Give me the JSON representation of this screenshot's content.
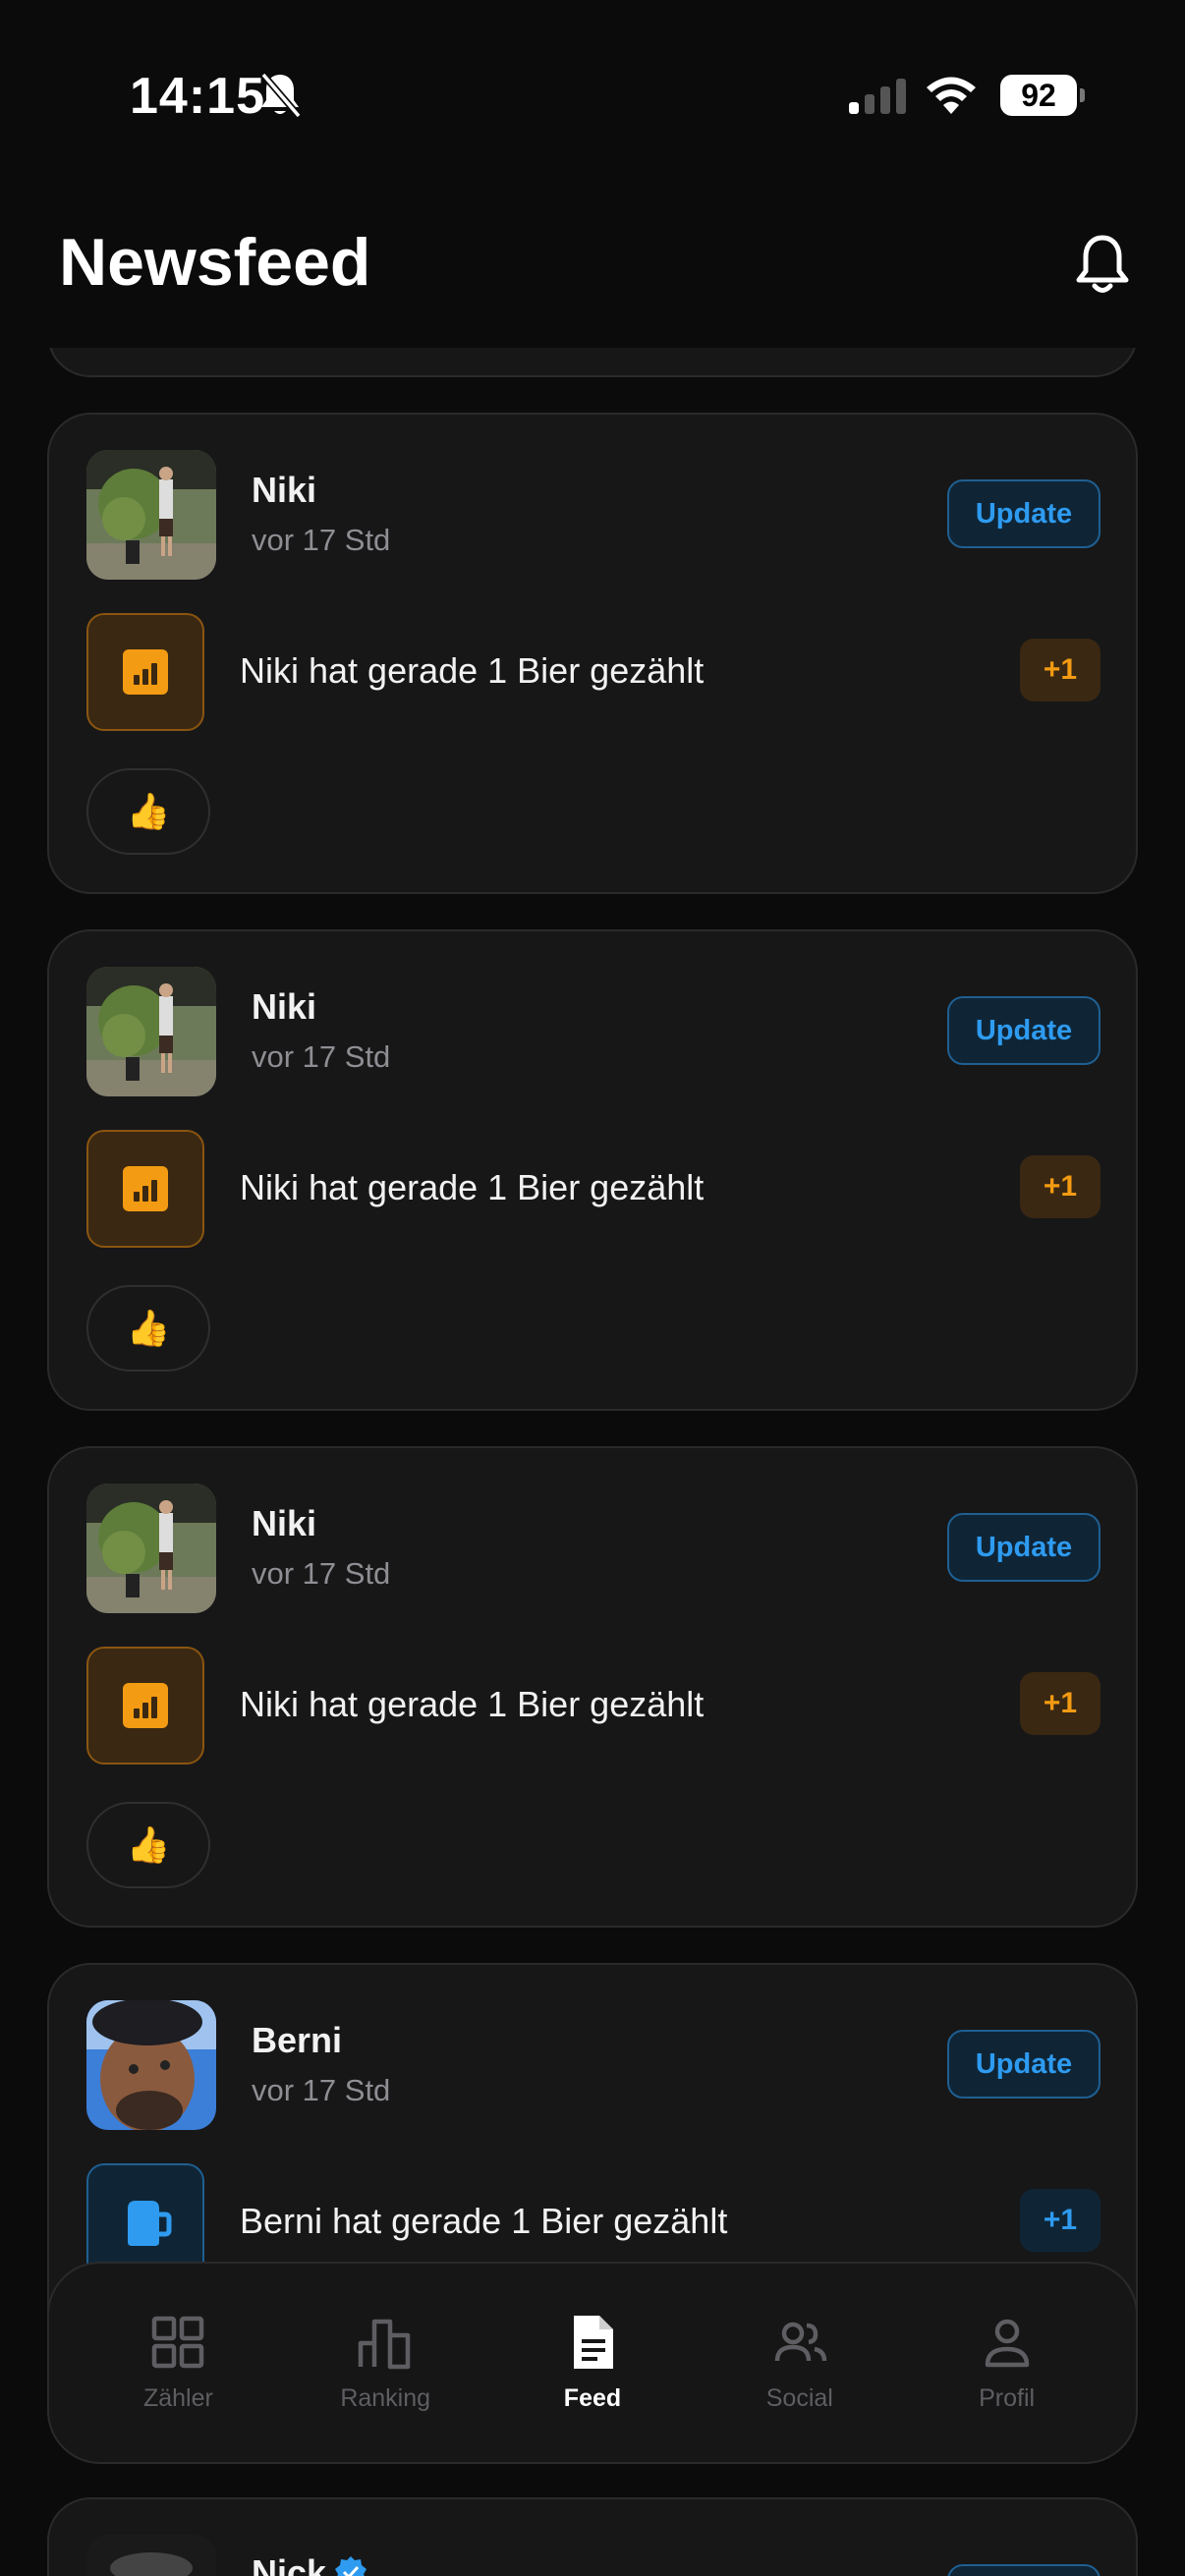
{
  "status": {
    "time": "14:15",
    "battery": "92"
  },
  "header": {
    "title": "Newsfeed"
  },
  "feed": [
    {
      "user": "Niki",
      "time": "vor 17 Std",
      "update": "Update",
      "activity": "Niki hat gerade 1 Bier gezählt",
      "badge": "+1",
      "reaction": "👍"
    },
    {
      "user": "Niki",
      "time": "vor 17 Std",
      "update": "Update",
      "activity": "Niki hat gerade 1 Bier gezählt",
      "badge": "+1",
      "reaction": "👍"
    },
    {
      "user": "Niki",
      "time": "vor 17 Std",
      "update": "Update",
      "activity": "Niki hat gerade 1 Bier gezählt",
      "badge": "+1",
      "reaction": "👍"
    },
    {
      "user": "Berni",
      "time": "vor 17 Std",
      "update": "Update",
      "activity": "Berni hat gerade 1 Bier gezählt",
      "badge": "+1"
    },
    {
      "user": "Nick"
    }
  ],
  "tabs": [
    {
      "label": "Zähler",
      "icon": "grid-icon"
    },
    {
      "label": "Ranking",
      "icon": "bar-chart-icon"
    },
    {
      "label": "Feed",
      "icon": "document-icon",
      "active": true
    },
    {
      "label": "Social",
      "icon": "people-icon"
    },
    {
      "label": "Profil",
      "icon": "person-icon"
    }
  ],
  "colors": {
    "accent_orange": "#f39b12",
    "accent_blue": "#2e9bf0",
    "background": "#0b0b0c",
    "card": "#171718"
  }
}
